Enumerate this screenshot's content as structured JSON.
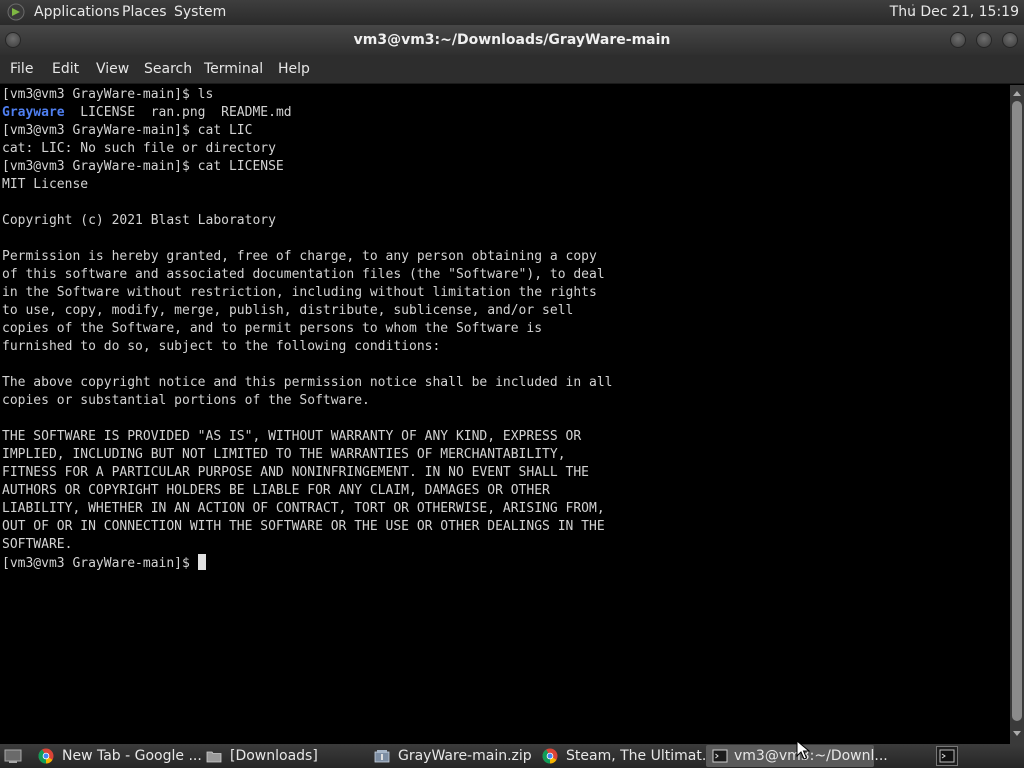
{
  "top_panel": {
    "menus": [
      "Applications",
      "Places",
      "System"
    ],
    "clock": "Thu Dec 21, 15:19"
  },
  "window": {
    "title": "vm3@vm3:~/Downloads/GrayWare-main"
  },
  "menubar": [
    "File",
    "Edit",
    "View",
    "Search",
    "Terminal",
    "Help"
  ],
  "terminal": {
    "prompt": "[vm3@vm3 GrayWare-main]$ ",
    "lines": [
      "[vm3@vm3 GrayWare-main]$ ls",
      "",
      "[vm3@vm3 GrayWare-main]$ cat LIC",
      "cat: LIC: No such file or directory",
      "[vm3@vm3 GrayWare-main]$ cat LICENSE",
      "MIT License",
      "",
      "Copyright (c) 2021 Blast Laboratory",
      "",
      "Permission is hereby granted, free of charge, to any person obtaining a copy",
      "of this software and associated documentation files (the \"Software\"), to deal",
      "in the Software without restriction, including without limitation the rights",
      "to use, copy, modify, merge, publish, distribute, sublicense, and/or sell",
      "copies of the Software, and to permit persons to whom the Software is",
      "furnished to do so, subject to the following conditions:",
      "",
      "The above copyright notice and this permission notice shall be included in all",
      "copies or substantial portions of the Software.",
      "",
      "THE SOFTWARE IS PROVIDED \"AS IS\", WITHOUT WARRANTY OF ANY KIND, EXPRESS OR",
      "IMPLIED, INCLUDING BUT NOT LIMITED TO THE WARRANTIES OF MERCHANTABILITY,",
      "FITNESS FOR A PARTICULAR PURPOSE AND NONINFRINGEMENT. IN NO EVENT SHALL THE",
      "AUTHORS OR COPYRIGHT HOLDERS BE LIABLE FOR ANY CLAIM, DAMAGES OR OTHER",
      "LIABILITY, WHETHER IN AN ACTION OF CONTRACT, TORT OR OTHERWISE, ARISING FROM,",
      "OUT OF OR IN CONNECTION WITH THE SOFTWARE OR THE USE OR OTHER DEALINGS IN THE",
      "SOFTWARE."
    ],
    "ls_output": {
      "directory": "Grayware",
      "files": "  LICENSE  ran.png  README.md"
    },
    "dir_color": "#4f7ff0"
  },
  "taskbar": {
    "tasks": [
      {
        "label": "New Tab - Google ...",
        "icon": "chrome-icon"
      },
      {
        "label": "[Downloads]",
        "icon": "folder-icon"
      },
      {
        "label": "GrayWare-main.zip",
        "icon": "archive-icon"
      },
      {
        "label": "Steam, The Ultimat...",
        "icon": "chrome-icon"
      },
      {
        "label": "vm3@vm3:~/Downl...",
        "icon": "terminal-icon",
        "active": true
      }
    ]
  }
}
